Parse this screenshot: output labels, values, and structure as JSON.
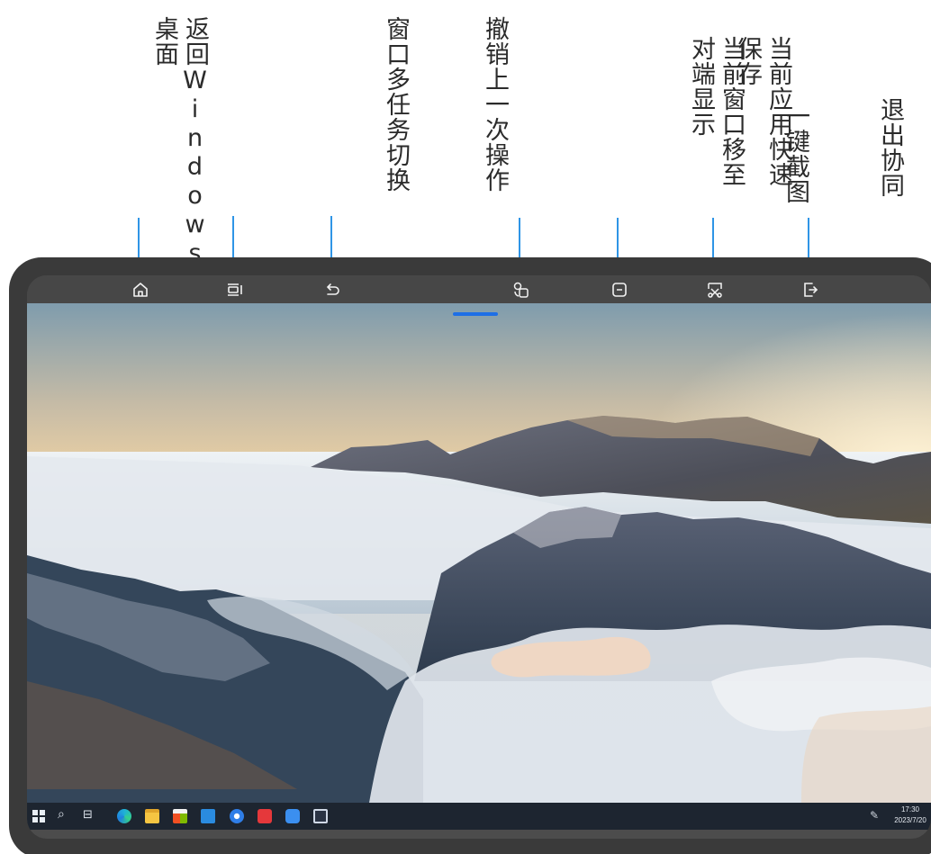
{
  "callouts": [
    {
      "name": "back-to-windows-desktop",
      "lines": [
        "返回Windows",
        "桌面"
      ]
    },
    {
      "name": "window-multitask-switch",
      "lines": [
        "窗口多任务切换"
      ]
    },
    {
      "name": "undo-last-action",
      "lines": [
        "撤销上一次操作"
      ]
    },
    {
      "name": "move-window-to-other-display",
      "lines": [
        "当前窗口移至",
        "对端显示"
      ]
    },
    {
      "name": "quick-save-current-app",
      "lines": [
        "当前应用快速",
        "保存"
      ]
    },
    {
      "name": "one-click-screenshot",
      "lines": [
        "一键截图"
      ]
    },
    {
      "name": "exit-collaboration",
      "lines": [
        "退出协同"
      ]
    }
  ],
  "toolbar_icons": [
    {
      "name": "home-icon"
    },
    {
      "name": "task-switch-icon"
    },
    {
      "name": "undo-icon"
    },
    {
      "name": "window-transfer-icon"
    },
    {
      "name": "save-icon"
    },
    {
      "name": "screenshot-icon"
    },
    {
      "name": "exit-icon"
    }
  ],
  "taskbar": {
    "apps": [
      {
        "name": "edge-icon",
        "color": "#1fb0d8"
      },
      {
        "name": "file-explorer-icon",
        "color": "#f5c542"
      },
      {
        "name": "microsoft-store-icon",
        "color": "#f3f3f3"
      },
      {
        "name": "mail-icon",
        "color": "#2a8be0"
      },
      {
        "name": "app-blue-circle-icon",
        "color": "#2f7ee8"
      },
      {
        "name": "app-red-icon",
        "color": "#e5383b"
      },
      {
        "name": "onedrive-icon",
        "color": "#3b8ff0"
      },
      {
        "name": "collaboration-app-icon",
        "color": "#cfd8e6"
      }
    ],
    "time": "17:30",
    "date": "2023/7/20"
  },
  "colors": {
    "accent": "#2f95e6",
    "handle": "#1e6fe6",
    "frame": "#3a3a3a",
    "taskbar": "#1d2530"
  }
}
